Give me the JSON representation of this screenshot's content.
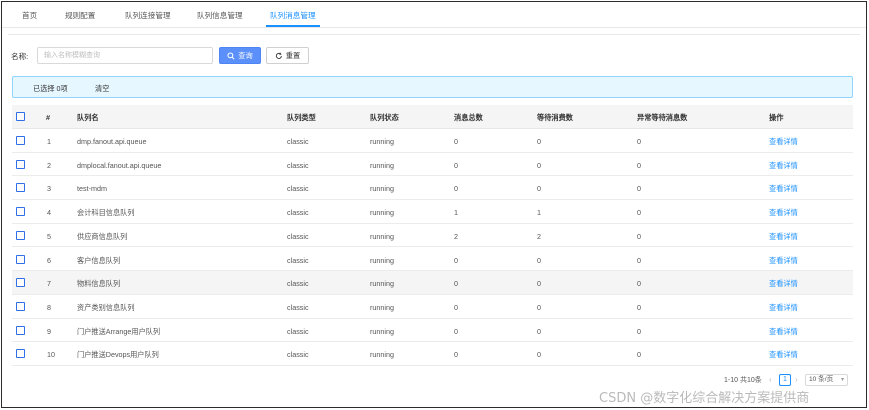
{
  "tabs": [
    {
      "label": "首页",
      "active": false
    },
    {
      "label": "规则配置",
      "active": false
    },
    {
      "label": "队列连接管理",
      "active": false
    },
    {
      "label": "队列信息管理",
      "active": false
    },
    {
      "label": "队列消息管理",
      "active": true
    }
  ],
  "search": {
    "label": "名称:",
    "placeholder": "输入名称模糊查询",
    "value": "",
    "query_label": "查询",
    "reset_label": "重置"
  },
  "alert": {
    "selected_text": "已选择 0项",
    "clear_label": "清空"
  },
  "table": {
    "columns": [
      "#",
      "队列名",
      "队列类型",
      "队列状态",
      "消息总数",
      "等待消费数",
      "异常等待消息数",
      "操作"
    ],
    "rows": [
      {
        "index": "1",
        "name": "dmp.fanout.api.queue",
        "type": "classic",
        "status": "running",
        "total": "0",
        "waiting": "0",
        "error_waiting": "0",
        "action": "查看详情"
      },
      {
        "index": "2",
        "name": "dmplocal.fanout.api.queue",
        "type": "classic",
        "status": "running",
        "total": "0",
        "waiting": "0",
        "error_waiting": "0",
        "action": "查看详情"
      },
      {
        "index": "3",
        "name": "test-mdm",
        "type": "classic",
        "status": "running",
        "total": "0",
        "waiting": "0",
        "error_waiting": "0",
        "action": "查看详情"
      },
      {
        "index": "4",
        "name": "会计科目信息队列",
        "type": "classic",
        "status": "running",
        "total": "1",
        "waiting": "1",
        "error_waiting": "0",
        "action": "查看详情"
      },
      {
        "index": "5",
        "name": "供应商信息队列",
        "type": "classic",
        "status": "running",
        "total": "2",
        "waiting": "2",
        "error_waiting": "0",
        "action": "查看详情"
      },
      {
        "index": "6",
        "name": "客户信息队列",
        "type": "classic",
        "status": "running",
        "total": "0",
        "waiting": "0",
        "error_waiting": "0",
        "action": "查看详情"
      },
      {
        "index": "7",
        "name": "物料信息队列",
        "type": "classic",
        "status": "running",
        "total": "0",
        "waiting": "0",
        "error_waiting": "0",
        "action": "查看详情"
      },
      {
        "index": "8",
        "name": "资产类别信息队列",
        "type": "classic",
        "status": "running",
        "total": "0",
        "waiting": "0",
        "error_waiting": "0",
        "action": "查看详情"
      },
      {
        "index": "9",
        "name": "门户推送Arrange用户队列",
        "type": "classic",
        "status": "running",
        "total": "0",
        "waiting": "0",
        "error_waiting": "0",
        "action": "查看详情"
      },
      {
        "index": "10",
        "name": "门户推送Devops用户队列",
        "type": "classic",
        "status": "running",
        "total": "0",
        "waiting": "0",
        "error_waiting": "0",
        "action": "查看详情"
      }
    ]
  },
  "pagination": {
    "total_text": "1-10 共10条",
    "prev": "‹",
    "current_page": "1",
    "next": "›",
    "page_size": "10 条/页"
  },
  "watermark": "CSDN @数字化综合解决方案提供商",
  "colors": {
    "accent": "#1890ff",
    "query_button": "#5b8ff9",
    "alert_bg": "#e6f7ff",
    "alert_border": "#91d5ff"
  }
}
